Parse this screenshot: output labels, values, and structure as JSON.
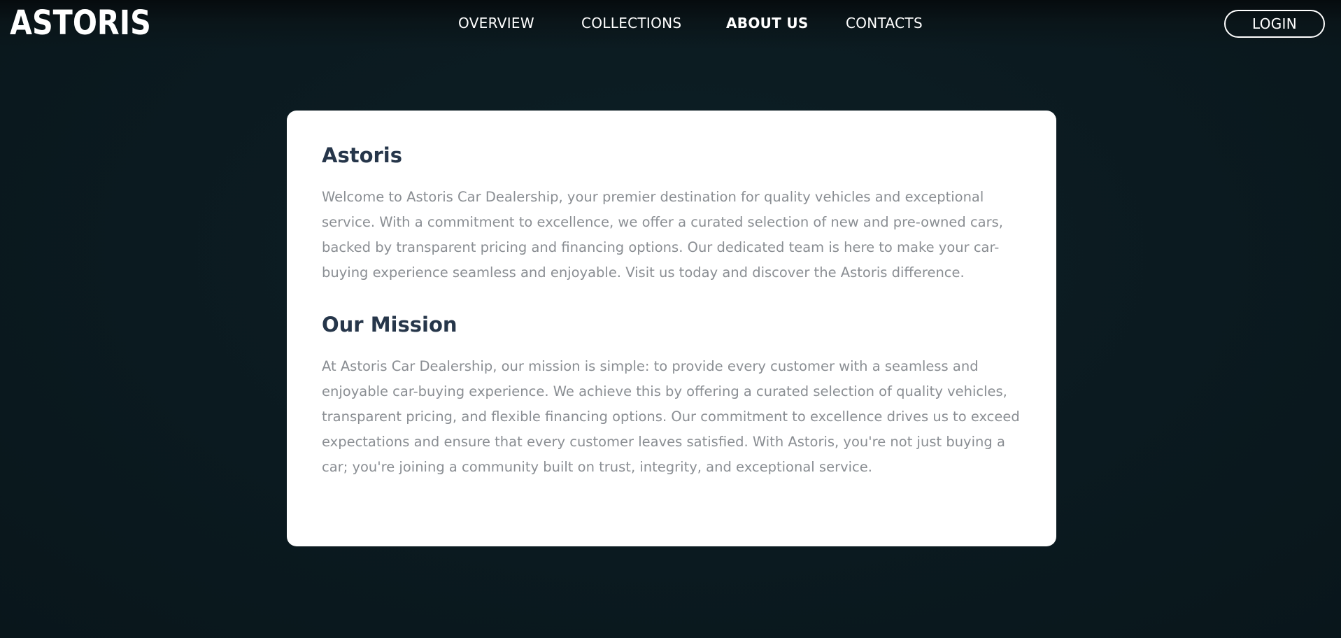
{
  "header": {
    "logo_text": "ASTORIS",
    "nav": [
      {
        "label": "OVERVIEW",
        "active": false
      },
      {
        "label": "COLLECTIONS",
        "active": false
      },
      {
        "label": "ABOUT US",
        "active": true
      },
      {
        "label": "CONTACTS",
        "active": false
      }
    ],
    "login_label": "LOGIN"
  },
  "about": {
    "title": "Astoris",
    "intro": "Welcome to Astoris Car Dealership, your premier destination for quality vehicles and exceptional service. With a commitment to excellence, we offer a curated selection of new and pre-owned cars, backed by transparent pricing and financing options. Our dedicated team is here to make your car-buying experience seamless and enjoyable. Visit us today and discover the Astoris difference.",
    "mission_title": "Our Mission",
    "mission": "At Astoris Car Dealership, our mission is simple: to provide every customer with a seamless and enjoyable car-buying experience. We achieve this by offering a curated selection of quality vehicles, transparent pricing, and flexible financing options. Our commitment to excellence drives us to exceed expectations and ensure that every customer leaves satisfied. With Astoris, you're not just buying a car; you're joining a community built on trust, integrity, and exceptional service."
  },
  "colors": {
    "background": "#0b1a20",
    "card": "#ffffff",
    "heading": "#26364a",
    "body_text": "#8a8e93",
    "nav_text": "#ffffff"
  }
}
